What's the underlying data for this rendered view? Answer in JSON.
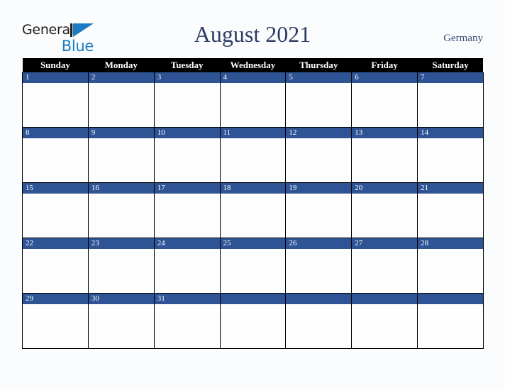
{
  "brand": {
    "name_part1": "General",
    "name_part2": "Blue",
    "mark": "triangle-logo-icon",
    "accent_color": "#1b7cc1",
    "text_color": "#231f20"
  },
  "header": {
    "title": "August 2021",
    "month": "August",
    "year": "2021",
    "locale": "Germany",
    "title_color": "#2c3c63"
  },
  "calendar": {
    "weekday_headers": [
      "Sunday",
      "Monday",
      "Tuesday",
      "Wednesday",
      "Thursday",
      "Friday",
      "Saturday"
    ],
    "header_bg": "#000000",
    "header_text": "#ffffff",
    "daynum_bg": "#2e5496",
    "daynum_text": "#ffffff",
    "cell_bg": "#fdfdfe",
    "grid_line": "#000000",
    "weeks": [
      {
        "days": [
          {
            "num": "1",
            "empty": false
          },
          {
            "num": "2",
            "empty": false
          },
          {
            "num": "3",
            "empty": false
          },
          {
            "num": "4",
            "empty": false
          },
          {
            "num": "5",
            "empty": false
          },
          {
            "num": "6",
            "empty": false
          },
          {
            "num": "7",
            "empty": false
          }
        ]
      },
      {
        "days": [
          {
            "num": "8",
            "empty": false
          },
          {
            "num": "9",
            "empty": false
          },
          {
            "num": "10",
            "empty": false
          },
          {
            "num": "11",
            "empty": false
          },
          {
            "num": "12",
            "empty": false
          },
          {
            "num": "13",
            "empty": false
          },
          {
            "num": "14",
            "empty": false
          }
        ]
      },
      {
        "days": [
          {
            "num": "15",
            "empty": false
          },
          {
            "num": "16",
            "empty": false
          },
          {
            "num": "17",
            "empty": false
          },
          {
            "num": "18",
            "empty": false
          },
          {
            "num": "19",
            "empty": false
          },
          {
            "num": "20",
            "empty": false
          },
          {
            "num": "21",
            "empty": false
          }
        ]
      },
      {
        "days": [
          {
            "num": "22",
            "empty": false
          },
          {
            "num": "23",
            "empty": false
          },
          {
            "num": "24",
            "empty": false
          },
          {
            "num": "25",
            "empty": false
          },
          {
            "num": "26",
            "empty": false
          },
          {
            "num": "27",
            "empty": false
          },
          {
            "num": "28",
            "empty": false
          }
        ]
      },
      {
        "days": [
          {
            "num": "29",
            "empty": false
          },
          {
            "num": "30",
            "empty": false
          },
          {
            "num": "31",
            "empty": false
          },
          {
            "num": "",
            "empty": true
          },
          {
            "num": "",
            "empty": true
          },
          {
            "num": "",
            "empty": true
          },
          {
            "num": "",
            "empty": true
          }
        ]
      }
    ]
  }
}
